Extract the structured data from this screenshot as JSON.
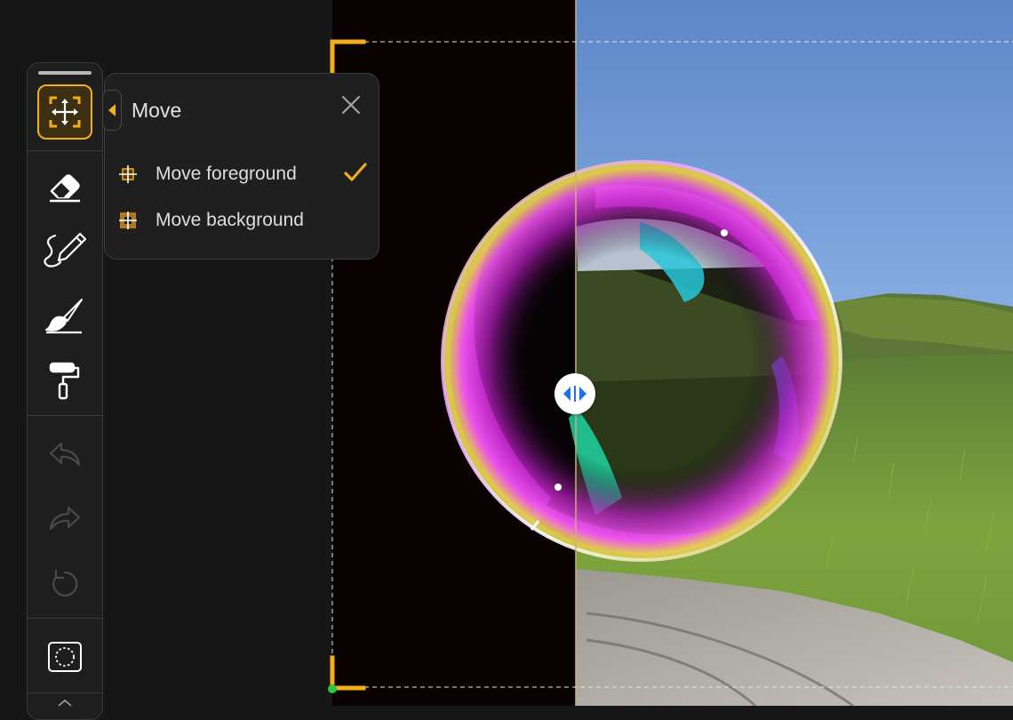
{
  "popover": {
    "title": "Move",
    "items": [
      {
        "label": "Move foreground",
        "icon": "move-foreground-icon",
        "checked": true
      },
      {
        "label": "Move background",
        "icon": "move-background-icon",
        "checked": false
      }
    ]
  },
  "toolbar": {
    "tools": [
      {
        "name": "move",
        "icon": "move-icon",
        "active": true
      },
      {
        "name": "eraser",
        "icon": "eraser-icon",
        "active": false
      },
      {
        "name": "draw",
        "icon": "pencil-squiggle-icon",
        "active": false
      },
      {
        "name": "brush",
        "icon": "brush-icon",
        "active": false
      },
      {
        "name": "paint-roller",
        "icon": "paint-roller-icon",
        "active": false
      },
      {
        "name": "undo",
        "icon": "undo-icon",
        "enabled": false
      },
      {
        "name": "redo",
        "icon": "redo-icon",
        "enabled": false
      },
      {
        "name": "reset",
        "icon": "reset-icon",
        "enabled": false
      },
      {
        "name": "selection",
        "icon": "selection-icon",
        "active": false
      }
    ]
  },
  "colors": {
    "accent": "#f4ae1b",
    "compare_handle_arrows": "#1a73e8",
    "origin_point": "#28c840"
  }
}
